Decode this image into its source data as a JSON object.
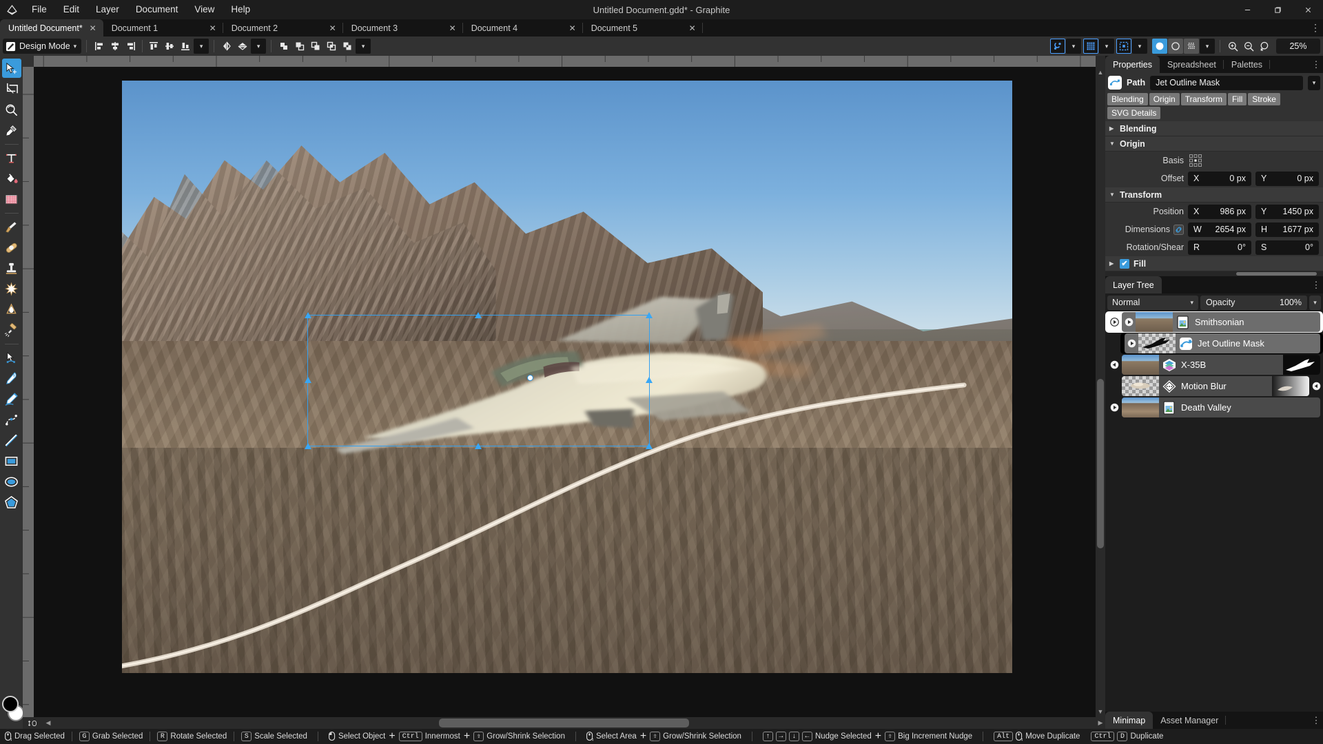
{
  "window": {
    "title": "Untitled Document.gdd* - Graphite",
    "logo_icon": "graphite-logo-icon",
    "minimize_label": "–",
    "maximize_label": "❐",
    "close_label": "✕"
  },
  "menubar": {
    "items": [
      {
        "label": "File",
        "name": "menu-file"
      },
      {
        "label": "Edit",
        "name": "menu-edit"
      },
      {
        "label": "Layer",
        "name": "menu-layer"
      },
      {
        "label": "Document",
        "name": "menu-document"
      },
      {
        "label": "View",
        "name": "menu-view"
      },
      {
        "label": "Help",
        "name": "menu-help"
      }
    ]
  },
  "tabs": {
    "close_glyph": "✕",
    "overflow_glyph": "⋮",
    "items": [
      {
        "label": "Untitled Document*",
        "active": true
      },
      {
        "label": "Document 1",
        "active": false
      },
      {
        "label": "Document 2",
        "active": false
      },
      {
        "label": "Document 3",
        "active": false
      },
      {
        "label": "Document 4",
        "active": false
      },
      {
        "label": "Document 5",
        "active": false
      }
    ]
  },
  "toolbar": {
    "mode_label": "Design Mode",
    "mode_caret": "⌄",
    "align_group": [
      {
        "name": "align-left-icon",
        "title": "Align Left"
      },
      {
        "name": "align-horizontal-center-icon",
        "title": "Align Horizontal Center"
      },
      {
        "name": "align-right-icon",
        "title": "Align Right"
      },
      {
        "name": "align-top-icon",
        "title": "Align Top"
      },
      {
        "name": "align-vertical-center-icon",
        "title": "Align Vertical Center"
      },
      {
        "name": "align-bottom-icon",
        "title": "Align Bottom"
      }
    ],
    "flip_group": [
      {
        "name": "flip-horizontal-icon",
        "title": "Flip Horizontal"
      },
      {
        "name": "flip-vertical-icon",
        "title": "Flip Vertical"
      }
    ],
    "boolean_group": [
      {
        "name": "boolean-union-icon",
        "title": "Union"
      },
      {
        "name": "boolean-subtract-front-icon",
        "title": "Subtract Front"
      },
      {
        "name": "boolean-subtract-back-icon",
        "title": "Subtract Back"
      },
      {
        "name": "boolean-intersect-icon",
        "title": "Intersect"
      },
      {
        "name": "boolean-difference-icon",
        "title": "Difference"
      }
    ],
    "snapping_group": [
      {
        "name": "snapping-icon",
        "title": "Snapping",
        "active": true
      },
      {
        "name": "grid-icon",
        "title": "Grid",
        "active": true
      },
      {
        "name": "overlays-icon",
        "title": "Overlays",
        "active": true
      }
    ],
    "view_mode_group": [
      {
        "name": "view-mode-normal-icon",
        "title": "Normal",
        "active": true
      },
      {
        "name": "view-mode-outline-icon",
        "title": "Outline",
        "active": false
      },
      {
        "name": "view-mode-pixels-icon",
        "title": "Pixels",
        "active": false
      }
    ],
    "zoom_group": [
      {
        "name": "zoom-in-icon",
        "title": "Zoom In"
      },
      {
        "name": "zoom-out-icon",
        "title": "Zoom Out"
      },
      {
        "name": "zoom-reset-icon",
        "title": "Reset Zoom"
      }
    ],
    "zoom_value": "25%"
  },
  "tools": {
    "top": [
      {
        "name": "tool-select",
        "label": "Select Tool",
        "active": true
      },
      {
        "name": "tool-artboard",
        "label": "Artboard Tool",
        "active": false
      },
      {
        "name": "tool-navigate",
        "label": "Navigate Tool",
        "active": false
      },
      {
        "name": "tool-eyedropper",
        "label": "Eyedropper Tool",
        "active": false
      }
    ],
    "group2": [
      {
        "name": "tool-text",
        "label": "Text Tool",
        "active": false
      },
      {
        "name": "tool-fill",
        "label": "Fill Tool",
        "active": false
      },
      {
        "name": "tool-gradient",
        "label": "Gradient Tool",
        "active": false
      }
    ],
    "group3": [
      {
        "name": "tool-brush",
        "label": "Brush Tool",
        "active": false
      },
      {
        "name": "tool-heal",
        "label": "Heal Tool",
        "active": false
      },
      {
        "name": "tool-clone",
        "label": "Clone Tool",
        "active": false
      },
      {
        "name": "tool-patch",
        "label": "Patch Tool",
        "active": false
      },
      {
        "name": "tool-detail",
        "label": "Detail Tool",
        "active": false
      },
      {
        "name": "tool-relight",
        "label": "Relight Tool",
        "active": false
      }
    ],
    "group4": [
      {
        "name": "tool-path",
        "label": "Path Tool",
        "active": false
      },
      {
        "name": "tool-pen",
        "label": "Pen Tool",
        "active": false
      },
      {
        "name": "tool-freehand",
        "label": "Freehand Tool",
        "active": false
      },
      {
        "name": "tool-spline",
        "label": "Spline Tool",
        "active": false
      },
      {
        "name": "tool-line",
        "label": "Line Tool",
        "active": false
      },
      {
        "name": "tool-rectangle",
        "label": "Rectangle Tool",
        "active": false
      },
      {
        "name": "tool-ellipse",
        "label": "Ellipse Tool",
        "active": false
      },
      {
        "name": "tool-polygon",
        "label": "Polygon Tool",
        "active": false
      }
    ],
    "swatches": {
      "primary_color": "#000000",
      "secondary_color": "#ffffff"
    }
  },
  "panels": {
    "right_tabs": [
      {
        "label": "Properties",
        "active": true
      },
      {
        "label": "Spreadsheet",
        "active": false
      },
      {
        "label": "Palettes",
        "active": false
      }
    ],
    "overflow_glyph": "⋮"
  },
  "properties": {
    "node_type": "Path",
    "node_icon": "path-node-icon",
    "node_name": "Jet Outline Mask",
    "caret": "⌄",
    "chips": [
      "Blending",
      "Origin",
      "Transform",
      "Fill",
      "Stroke",
      "SVG Details"
    ],
    "sections": {
      "blending": {
        "title": "Blending",
        "expanded": false,
        "arrow": "▶"
      },
      "origin": {
        "title": "Origin",
        "expanded": true,
        "arrow": "▼",
        "basis_label": "Basis",
        "basis_icon": "origin-basis-grid-icon",
        "offset_label": "Offset",
        "offset_x_key": "X",
        "offset_x_value": "0 px",
        "offset_y_key": "Y",
        "offset_y_value": "0 px"
      },
      "transform": {
        "title": "Transform",
        "expanded": true,
        "arrow": "▼",
        "position_label": "Position",
        "position_x_key": "X",
        "position_x_value": "986 px",
        "position_y_key": "Y",
        "position_y_value": "1450 px",
        "dimensions_label": "Dimensions",
        "dimensions_link_icon": "link-icon",
        "dimensions_w_key": "W",
        "dimensions_w_value": "2654 px",
        "dimensions_h_key": "H",
        "dimensions_h_value": "1677 px",
        "rotation_label": "Rotation/Shear",
        "rotation_r_key": "R",
        "rotation_r_value": "0°",
        "rotation_s_key": "S",
        "rotation_s_value": "0°"
      },
      "fill": {
        "title": "Fill",
        "expanded": false,
        "arrow": "▶",
        "checked": true,
        "check_glyph": "✔"
      }
    }
  },
  "layer_tree": {
    "tab_label": "Layer Tree",
    "overflow_glyph": "⋮",
    "blend_mode": "Normal",
    "blend_caret": "⌄",
    "opacity_label": "Opacity",
    "opacity_value": "100%",
    "opacity_caret": "⌄",
    "layers": [
      {
        "name": "Smithsonian",
        "icon": "image-document-icon",
        "depth": 0,
        "selected": true,
        "expanded": true,
        "visible": true,
        "thumb": "photo",
        "expand_glyph": "▶"
      },
      {
        "name": "Jet Outline Mask",
        "icon": "path-node-icon",
        "depth": 1,
        "selected": true,
        "expanded": false,
        "visible": true,
        "thumb": "checker-jet",
        "expand_glyph": "▶"
      },
      {
        "name": "X-35B",
        "icon": "layers-stack-icon",
        "depth": 1,
        "selected": false,
        "expanded": false,
        "visible": true,
        "thumb": "photo",
        "preview": "jet-silhouette",
        "expand_glyph": "▶"
      },
      {
        "name": "Motion Blur",
        "icon": "motion-blur-node-icon",
        "depth": 1,
        "selected": false,
        "expanded": false,
        "visible": true,
        "thumb": "checker-jet-blur",
        "preview": "blur-gradient",
        "expand_glyph": "◀"
      },
      {
        "name": "Death Valley",
        "icon": "image-document-icon",
        "depth": 0,
        "selected": false,
        "expanded": false,
        "visible": true,
        "thumb": "valley",
        "expand_glyph": "▶"
      }
    ]
  },
  "bottom_panel": {
    "tabs": [
      {
        "label": "Minimap",
        "active": true
      },
      {
        "label": "Asset Manager",
        "active": false
      }
    ],
    "overflow_glyph": "⋮"
  },
  "statusbar": {
    "hints": [
      {
        "icon": "mouse-drag-icon",
        "keys": [],
        "text": "Drag Selected"
      },
      {
        "icon": null,
        "keys": [
          "G"
        ],
        "text": "Grab Selected"
      },
      {
        "icon": null,
        "keys": [
          "R"
        ],
        "text": "Rotate Selected"
      },
      {
        "icon": null,
        "keys": [
          "S"
        ],
        "text": "Scale Selected"
      },
      {
        "sep": true
      },
      {
        "icon": "mouse-left-icon",
        "keys": [],
        "text": "Select Object"
      },
      {
        "plus": true
      },
      {
        "icon": null,
        "keys": [
          "Ctrl"
        ],
        "text": "Innermost"
      },
      {
        "plus": true
      },
      {
        "icon": null,
        "keys": [
          "⇧"
        ],
        "text": "Grow/Shrink Selection"
      },
      {
        "sep": true
      },
      {
        "icon": "mouse-drag-icon",
        "keys": [],
        "text": "Select Area"
      },
      {
        "plus": true
      },
      {
        "icon": null,
        "keys": [
          "⇧"
        ],
        "text": "Grow/Shrink Selection"
      },
      {
        "sep": true
      },
      {
        "icon": null,
        "keys": [
          "↑",
          "→",
          "↓",
          "←"
        ],
        "text": "Nudge Selected"
      },
      {
        "plus": true
      },
      {
        "icon": null,
        "keys": [
          "⇧"
        ],
        "text": "Big Increment Nudge"
      },
      {
        "sep": true
      },
      {
        "icon": "mouse-drag-icon",
        "keys": [
          "Alt"
        ],
        "text": "Move Duplicate"
      },
      {
        "icon": null,
        "keys": [
          "Ctrl",
          "D"
        ],
        "text": "Duplicate"
      }
    ]
  },
  "canvas": {
    "selection": {
      "pivot_label": "transform-pivot",
      "handle_count": 8
    },
    "artboard_label": "artboard-photo"
  },
  "colors": {
    "accent": "#3a9bdc",
    "selection": "#33a0f0",
    "panel_bg": "#323232",
    "window_bg": "#1d1d1d",
    "canvas_bg": "#111111"
  }
}
